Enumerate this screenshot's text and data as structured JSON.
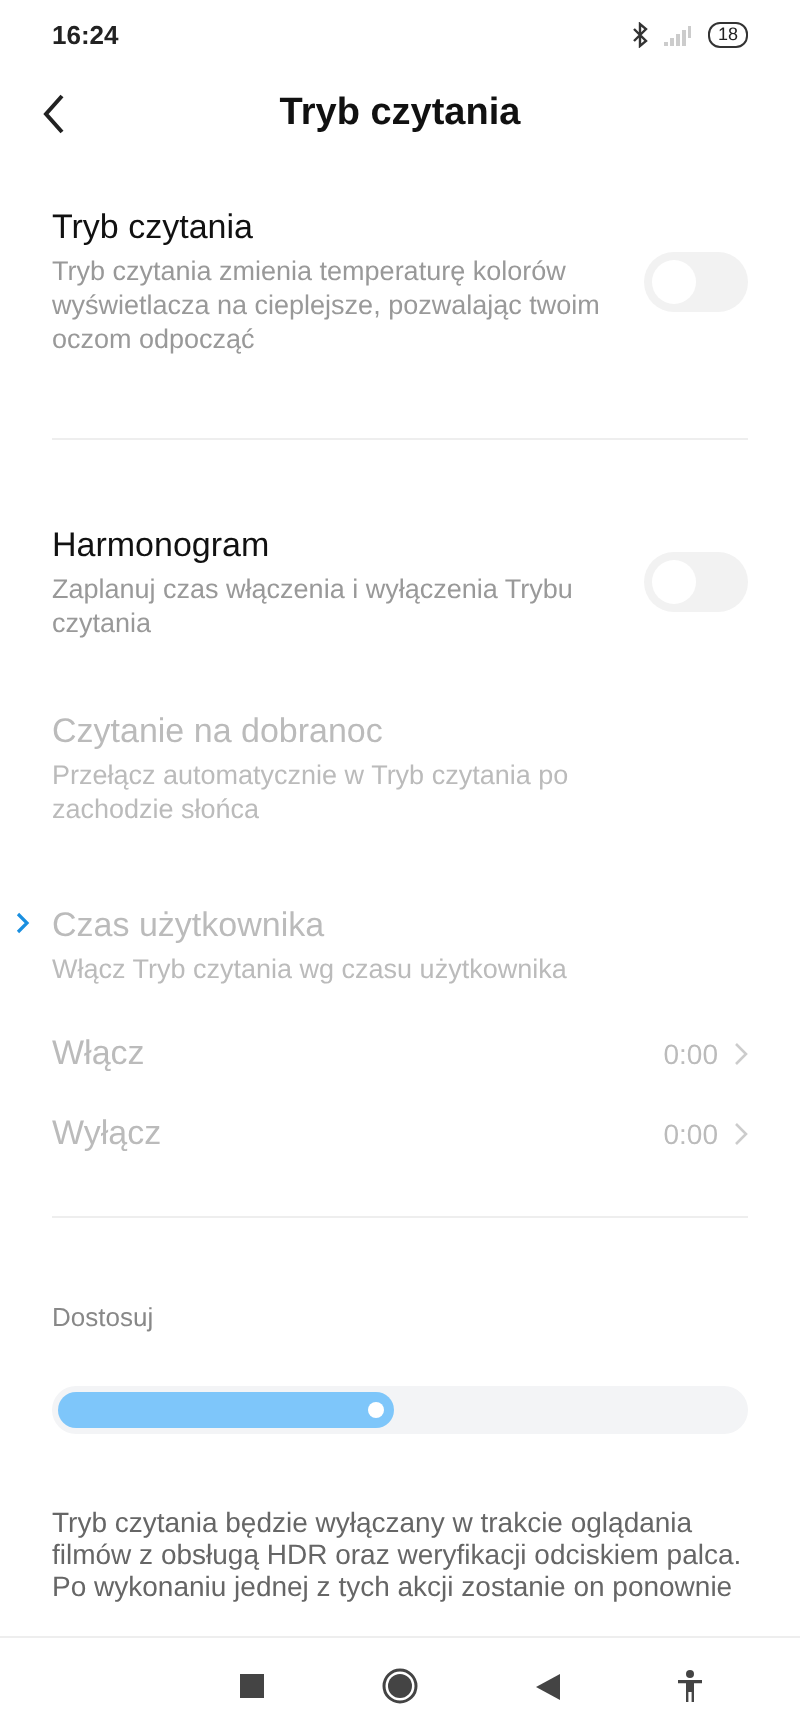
{
  "status_bar": {
    "time": "16:24",
    "battery": "18"
  },
  "header": {
    "title": "Tryb czytania"
  },
  "sections": [
    {
      "items": [
        {
          "kind": "toggle",
          "title": "Tryb czytania",
          "description": "Tryb czytania zmienia temperaturę kolorów wyświetlacza na cieplejsze, pozwalając twoim oczom odpocząć",
          "on": false,
          "disabled": false
        }
      ]
    },
    {
      "items": [
        {
          "kind": "toggle",
          "title": "Harmonogram",
          "description": "Zaplanuj czas włączenia i wyłączenia Trybu czytania",
          "on": false,
          "disabled": false
        },
        {
          "kind": "option",
          "title": "Czytanie na dobranoc",
          "description": "Przełącz automatycznie w Tryb czytania po zachodzie słońca",
          "selected": false,
          "disabled": true
        },
        {
          "kind": "option",
          "title": "Czas użytkownika",
          "description": "Włącz Tryb czytania wg czasu użytkownika",
          "selected": true,
          "disabled": true
        },
        {
          "kind": "time",
          "title": "Włącz",
          "value": "0:00",
          "disabled": true
        },
        {
          "kind": "time",
          "title": "Wyłącz",
          "value": "0:00",
          "disabled": true
        }
      ]
    },
    {
      "items": [
        {
          "kind": "slider",
          "title": "Dostosuj",
          "level": 0.5
        }
      ]
    }
  ],
  "note": "Tryb czytania będzie wyłączany w trakcie oglądania filmów z obsługą HDR oraz weryfikacji odciskiem palca. Po wykonaniu jednej z tych akcji zostanie on ponownie"
}
